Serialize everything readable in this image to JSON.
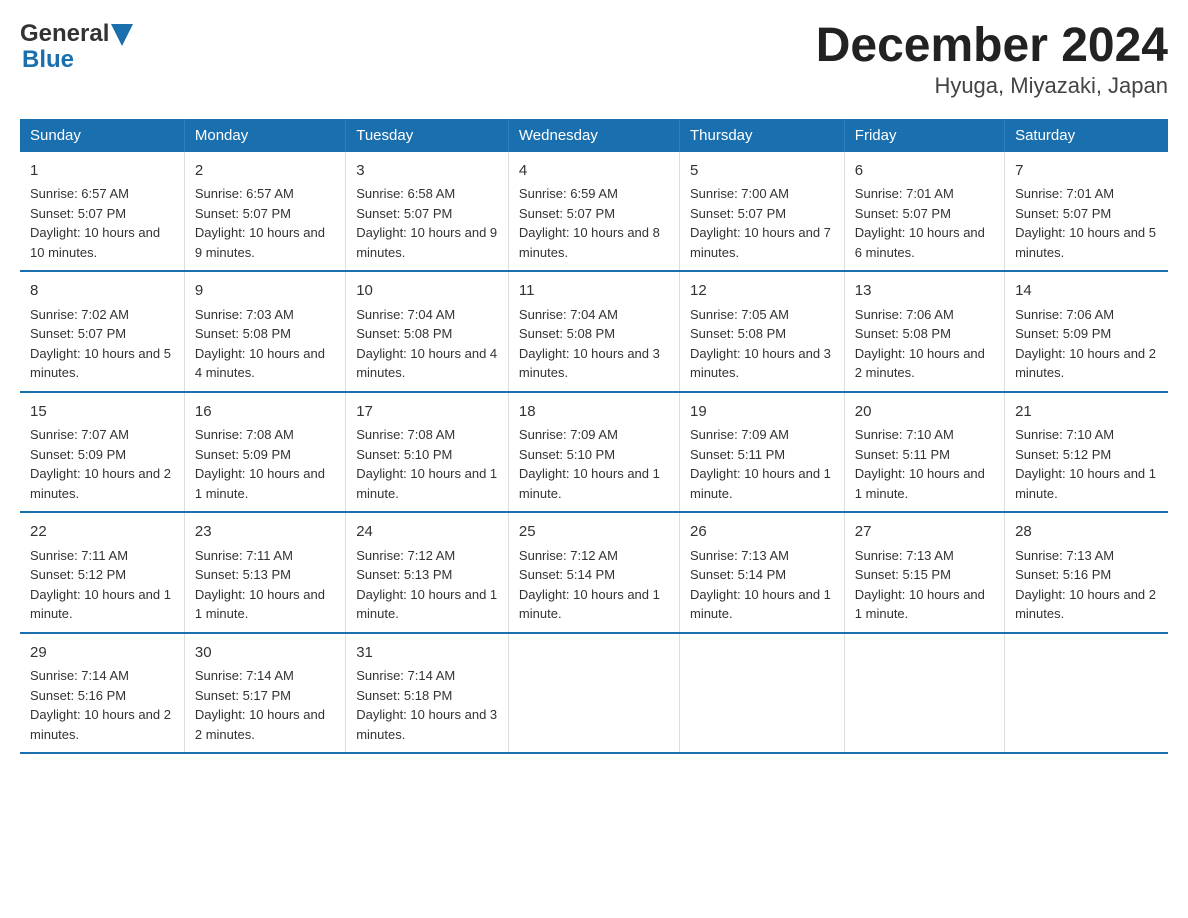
{
  "logo": {
    "text1": "General",
    "text2": "Blue"
  },
  "title": "December 2024",
  "subtitle": "Hyuga, Miyazaki, Japan",
  "days": [
    "Sunday",
    "Monday",
    "Tuesday",
    "Wednesday",
    "Thursday",
    "Friday",
    "Saturday"
  ],
  "weeks": [
    [
      {
        "date": "1",
        "sunrise": "6:57 AM",
        "sunset": "5:07 PM",
        "daylight": "10 hours and 10 minutes."
      },
      {
        "date": "2",
        "sunrise": "6:57 AM",
        "sunset": "5:07 PM",
        "daylight": "10 hours and 9 minutes."
      },
      {
        "date": "3",
        "sunrise": "6:58 AM",
        "sunset": "5:07 PM",
        "daylight": "10 hours and 9 minutes."
      },
      {
        "date": "4",
        "sunrise": "6:59 AM",
        "sunset": "5:07 PM",
        "daylight": "10 hours and 8 minutes."
      },
      {
        "date": "5",
        "sunrise": "7:00 AM",
        "sunset": "5:07 PM",
        "daylight": "10 hours and 7 minutes."
      },
      {
        "date": "6",
        "sunrise": "7:01 AM",
        "sunset": "5:07 PM",
        "daylight": "10 hours and 6 minutes."
      },
      {
        "date": "7",
        "sunrise": "7:01 AM",
        "sunset": "5:07 PM",
        "daylight": "10 hours and 5 minutes."
      }
    ],
    [
      {
        "date": "8",
        "sunrise": "7:02 AM",
        "sunset": "5:07 PM",
        "daylight": "10 hours and 5 minutes."
      },
      {
        "date": "9",
        "sunrise": "7:03 AM",
        "sunset": "5:08 PM",
        "daylight": "10 hours and 4 minutes."
      },
      {
        "date": "10",
        "sunrise": "7:04 AM",
        "sunset": "5:08 PM",
        "daylight": "10 hours and 4 minutes."
      },
      {
        "date": "11",
        "sunrise": "7:04 AM",
        "sunset": "5:08 PM",
        "daylight": "10 hours and 3 minutes."
      },
      {
        "date": "12",
        "sunrise": "7:05 AM",
        "sunset": "5:08 PM",
        "daylight": "10 hours and 3 minutes."
      },
      {
        "date": "13",
        "sunrise": "7:06 AM",
        "sunset": "5:08 PM",
        "daylight": "10 hours and 2 minutes."
      },
      {
        "date": "14",
        "sunrise": "7:06 AM",
        "sunset": "5:09 PM",
        "daylight": "10 hours and 2 minutes."
      }
    ],
    [
      {
        "date": "15",
        "sunrise": "7:07 AM",
        "sunset": "5:09 PM",
        "daylight": "10 hours and 2 minutes."
      },
      {
        "date": "16",
        "sunrise": "7:08 AM",
        "sunset": "5:09 PM",
        "daylight": "10 hours and 1 minute."
      },
      {
        "date": "17",
        "sunrise": "7:08 AM",
        "sunset": "5:10 PM",
        "daylight": "10 hours and 1 minute."
      },
      {
        "date": "18",
        "sunrise": "7:09 AM",
        "sunset": "5:10 PM",
        "daylight": "10 hours and 1 minute."
      },
      {
        "date": "19",
        "sunrise": "7:09 AM",
        "sunset": "5:11 PM",
        "daylight": "10 hours and 1 minute."
      },
      {
        "date": "20",
        "sunrise": "7:10 AM",
        "sunset": "5:11 PM",
        "daylight": "10 hours and 1 minute."
      },
      {
        "date": "21",
        "sunrise": "7:10 AM",
        "sunset": "5:12 PM",
        "daylight": "10 hours and 1 minute."
      }
    ],
    [
      {
        "date": "22",
        "sunrise": "7:11 AM",
        "sunset": "5:12 PM",
        "daylight": "10 hours and 1 minute."
      },
      {
        "date": "23",
        "sunrise": "7:11 AM",
        "sunset": "5:13 PM",
        "daylight": "10 hours and 1 minute."
      },
      {
        "date": "24",
        "sunrise": "7:12 AM",
        "sunset": "5:13 PM",
        "daylight": "10 hours and 1 minute."
      },
      {
        "date": "25",
        "sunrise": "7:12 AM",
        "sunset": "5:14 PM",
        "daylight": "10 hours and 1 minute."
      },
      {
        "date": "26",
        "sunrise": "7:13 AM",
        "sunset": "5:14 PM",
        "daylight": "10 hours and 1 minute."
      },
      {
        "date": "27",
        "sunrise": "7:13 AM",
        "sunset": "5:15 PM",
        "daylight": "10 hours and 1 minute."
      },
      {
        "date": "28",
        "sunrise": "7:13 AM",
        "sunset": "5:16 PM",
        "daylight": "10 hours and 2 minutes."
      }
    ],
    [
      {
        "date": "29",
        "sunrise": "7:14 AM",
        "sunset": "5:16 PM",
        "daylight": "10 hours and 2 minutes."
      },
      {
        "date": "30",
        "sunrise": "7:14 AM",
        "sunset": "5:17 PM",
        "daylight": "10 hours and 2 minutes."
      },
      {
        "date": "31",
        "sunrise": "7:14 AM",
        "sunset": "5:18 PM",
        "daylight": "10 hours and 3 minutes."
      },
      null,
      null,
      null,
      null
    ]
  ]
}
